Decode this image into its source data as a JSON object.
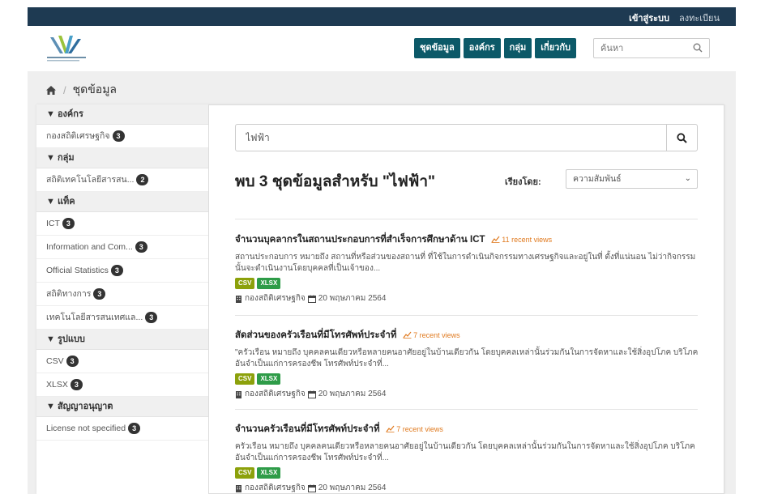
{
  "topbar": {
    "login": "เข้าสู่ระบบ",
    "register": "ลงทะเบียน"
  },
  "header": {
    "nav": [
      "ชุดข้อมูล",
      "องค์กร",
      "กลุ่ม",
      "เกี่ยวกับ"
    ],
    "search_placeholder": "ค้นหา"
  },
  "breadcrumb": {
    "current": "ชุดข้อมูล"
  },
  "sidebar": {
    "facets": [
      {
        "title": "องค์กร",
        "items": [
          {
            "label": "กองสถิติเศรษฐกิจ",
            "count": "3"
          }
        ]
      },
      {
        "title": "กลุ่ม",
        "items": [
          {
            "label": "สถิติเทคโนโลยีสารสน...",
            "count": "2"
          }
        ]
      },
      {
        "title": "แท็ค",
        "items": [
          {
            "label": "ICT",
            "count": "3"
          },
          {
            "label": "Information and Com...",
            "count": "3"
          },
          {
            "label": "Official Statistics",
            "count": "3"
          },
          {
            "label": "สถิติทางการ",
            "count": "3"
          },
          {
            "label": "เทคโนโลยีสารสนเทศแล...",
            "count": "3"
          }
        ]
      },
      {
        "title": "รูปแบบ",
        "items": [
          {
            "label": "CSV",
            "count": "3"
          },
          {
            "label": "XLSX",
            "count": "3"
          }
        ]
      },
      {
        "title": "สัญญาอนุญาต",
        "items": [
          {
            "label": "License not specified",
            "count": "3"
          }
        ]
      }
    ]
  },
  "search": {
    "value": "ไฟฟ้า"
  },
  "results": {
    "heading": "พบ 3 ชุดข้อมูลสำหรับ \"ไฟฟ้า\"",
    "sort_label": "เรียงโดย:",
    "sort_value": "ความสัมพันธ์",
    "datasets": [
      {
        "title": "จำนวนบุคลากรในสถานประกอบการที่สำเร็จการศึกษาด้าน ICT",
        "views": "11 recent views",
        "notes": "สถานประกอบการ หมายถึง สถานที่หรือส่วนของสถานที่ ที่ใช้ในการดำเนินกิจกรรมทางเศรษฐกิจและอยู่ในที่ ตั้งที่แน่นอน ไม่ว่ากิจกรรมนั้นจะดำเนินงานโดยบุคคลที่เป็นเจ้าของ...",
        "formats": [
          "CSV",
          "XLSX"
        ],
        "org": "กองสถิติเศรษฐกิจ",
        "date": "20 พฤษภาคม 2564"
      },
      {
        "title": "สัดส่วนของครัวเรือนที่มีโทรศัพท์ประจำที่",
        "views": "7 recent views",
        "notes": "\"ครัวเรือน หมายถึง บุคคลคนเดียวหรือหลายคนอาศัยอยู่ในบ้านเดียวกัน โดยบุคคลเหล่านั้นร่วมกันในการจัดหาและใช้สิ่งอุปโภค บริโภค อันจำเป็นแก่การครองชีพ โทรศัพท์ประจำที่...",
        "formats": [
          "CSV",
          "XLSX"
        ],
        "org": "กองสถิติเศรษฐกิจ",
        "date": "20 พฤษภาคม 2564"
      },
      {
        "title": "จำนวนครัวเรือนที่มีโทรศัพท์ประจำที่",
        "views": "7 recent views",
        "notes": "ครัวเรือน หมายถึง บุคคลคนเดียวหรือหลายคนอาศัยอยู่ในบ้านเดียวกัน โดยบุคคลเหล่านั้นร่วมกันในการจัดหาและใช้สิ่งอุปโภค บริโภค อันจำเป็นแก่การครองชีพ โทรศัพท์ประจำที่...",
        "formats": [
          "CSV",
          "XLSX"
        ],
        "org": "กองสถิติเศรษฐกิจ",
        "date": "20 พฤษภาคม 2564"
      }
    ]
  },
  "colors": {
    "topbar": "#1e3a52",
    "nav": "#0c5968",
    "views": "#e07a1f",
    "csv": "#8ca10b",
    "xlsx": "#2e9c48"
  }
}
